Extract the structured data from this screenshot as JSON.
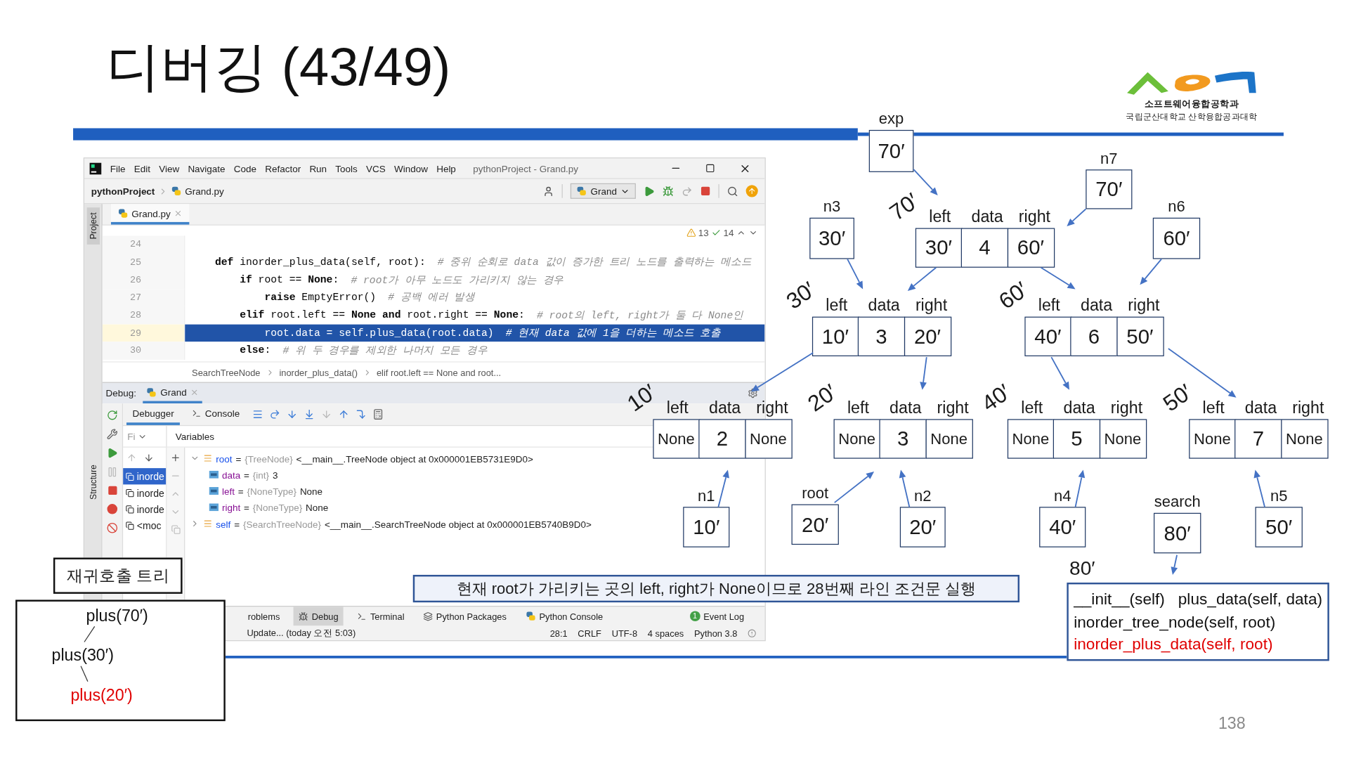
{
  "slide": {
    "title": "디버깅 (43/49)",
    "page_number": "138",
    "logo": {
      "name": "소프트웨어융합공학과",
      "subtitle": "국립군산대학교 산학융합공과대학"
    }
  },
  "ide": {
    "menu": [
      "File",
      "Edit",
      "View",
      "Navigate",
      "Code",
      "Refactor",
      "Run",
      "Tools",
      "VCS",
      "Window",
      "Help"
    ],
    "window_title": "pythonProject - Grand.py",
    "breadcrumb": [
      "pythonProject",
      "Grand.py"
    ],
    "run_config": "Grand",
    "side_tabs": [
      {
        "label": "Project",
        "selected": true
      },
      {
        "label": "Structure",
        "selected": false
      }
    ],
    "editor_tab": {
      "label": "Grand.py",
      "selected": true
    },
    "inspections": {
      "warnings": "13",
      "passed": "14"
    },
    "lines": [
      {
        "number": "24",
        "selected": false
      },
      {
        "number": "25",
        "code": "    **def** inorder_plus_data(self, root):",
        "comment": "# 중위 순회로 data 값이 증가한 트리 노드를 출력하는 메소드",
        "selected": false
      },
      {
        "number": "26",
        "code": "        **if** root == **None**:",
        "comment": "# root가 아무 노드도 가리키지 않는 경우",
        "selected": false
      },
      {
        "number": "27",
        "code": "            **raise** EmptyError()",
        "comment": "# 공백 에러 발생",
        "selected": false
      },
      {
        "number": "28",
        "code": "        **elif** root.left == **None** **and** root.right == **None**:",
        "comment": "# root의 left, right가 둘 다 None인",
        "selected": false
      },
      {
        "number": "29",
        "code": "            root.data = self.plus_data(root.data)",
        "comment": "# 현재 data 값에 1을 더하는 메소드 호출",
        "selected": true
      },
      {
        "number": "30",
        "code": "        **else**:",
        "comment": "# 위 두 경우를 제외한 나머지 모든 경우",
        "selected": false
      }
    ],
    "code_path": [
      "SearchTreeNode",
      "inorder_plus_data()",
      "elif root.left == None and root..."
    ],
    "debug": {
      "label": "Debug:",
      "session": {
        "label": "Grand",
        "selected": true
      },
      "tabs": [
        {
          "label": "Debugger",
          "selected": true
        },
        {
          "label": "Console",
          "selected": false
        }
      ],
      "frames_header": "Fi",
      "frames": [
        {
          "label": "inorde",
          "selected": true
        },
        {
          "label": "inorde",
          "selected": false
        },
        {
          "label": "inorde",
          "selected": false
        },
        {
          "label": "<moc",
          "selected": false
        }
      ],
      "variables_header": "Variables",
      "variables": [
        {
          "kind": "object",
          "name": "root",
          "sep": "=",
          "type": "{TreeNode}",
          "value": "<__main__.TreeNode object at 0x000001EB5731E9D0>",
          "expanded": true,
          "children": [
            {
              "kind": "primitive",
              "name": "data",
              "sep": "=",
              "type": "{int}",
              "value": "3"
            },
            {
              "kind": "primitive",
              "name": "left",
              "sep": "=",
              "type": "{NoneType}",
              "value": "None"
            },
            {
              "kind": "primitive",
              "name": "right",
              "sep": "=",
              "type": "{NoneType}",
              "value": "None"
            }
          ]
        },
        {
          "kind": "object",
          "name": "self",
          "sep": "=",
          "type": "{SearchTreeNode}",
          "value": "<__main__.SearchTreeNode object at 0x000001EB5740B9D0>",
          "expanded": false
        }
      ]
    },
    "tool_tabs": [
      {
        "kind": "problems",
        "label": "roblems",
        "selected": false
      },
      {
        "kind": "debug",
        "label": "Debug",
        "selected": true
      },
      {
        "kind": "terminal",
        "label": "Terminal",
        "selected": false
      },
      {
        "kind": "packages",
        "label": "Python Packages",
        "selected": false
      },
      {
        "kind": "console",
        "label": "Python Console",
        "selected": false
      }
    ],
    "event_log": {
      "label": "Event Log",
      "count": "1"
    },
    "status": {
      "message": "Update... (today 오전 5:03)",
      "position": "28:1",
      "line_separator": "CRLF",
      "encoding": "UTF-8",
      "indent": "4 spaces",
      "interpreter": "Python 3.8"
    }
  },
  "diagram": {
    "triples": [
      {
        "name": "70′",
        "labels": [
          "left",
          "data",
          "right"
        ],
        "cells": [
          "30′",
          "4",
          "60′"
        ]
      },
      {
        "name": "30′",
        "labels": [
          "left",
          "data",
          "right"
        ],
        "cells": [
          "10′",
          "3",
          "20′"
        ]
      },
      {
        "name": "60′",
        "labels": [
          "left",
          "data",
          "right"
        ],
        "cells": [
          "40′",
          "6",
          "50′"
        ]
      },
      {
        "name": "10′",
        "labels": [
          "left",
          "data",
          "right"
        ],
        "cells": [
          "None",
          "2",
          "None"
        ]
      },
      {
        "name": "20′",
        "labels": [
          "left",
          "data",
          "right"
        ],
        "cells": [
          "None",
          "3",
          "None"
        ]
      },
      {
        "name": "40′",
        "labels": [
          "left",
          "data",
          "right"
        ],
        "cells": [
          "None",
          "5",
          "None"
        ]
      },
      {
        "name": "50′",
        "labels": [
          "left",
          "data",
          "right"
        ],
        "cells": [
          "None",
          "7",
          "None"
        ]
      }
    ],
    "singles": [
      {
        "label": "exp",
        "value": "70′"
      },
      {
        "label": "n7",
        "value": "70′"
      },
      {
        "label": "n3",
        "value": "30′"
      },
      {
        "label": "n6",
        "value": "60′"
      },
      {
        "label": "n1",
        "value": "10′"
      },
      {
        "label": "root",
        "value": "20′"
      },
      {
        "label": "n2",
        "value": "20′"
      },
      {
        "label": "n4",
        "value": "40′"
      },
      {
        "label": "search",
        "value": "80′"
      },
      {
        "label": "n5",
        "value": "50′"
      }
    ],
    "new_value": "80′"
  },
  "caption": "현재 root가 가리키는 곳의 left, right가 None이므로 28번째 라인 조건문 실행",
  "recursion_tree": {
    "title": "재귀호출 트리",
    "calls": [
      {
        "text": "plus(70′)",
        "current": false,
        "children": [
          {
            "text": "plus(30′)",
            "current": false,
            "children": [
              {
                "text": "plus(20′)",
                "current": true
              }
            ]
          }
        ]
      }
    ]
  },
  "methods_box": {
    "rows": [
      {
        "items": [
          {
            "text": "__init__(self)",
            "current": false
          },
          {
            "text": "plus_data(self, data)",
            "current": false
          }
        ]
      },
      {
        "items": [
          {
            "text": "inorder_tree_node(self, root)",
            "current": false
          }
        ]
      },
      {
        "items": [
          {
            "text": "inorder_plus_data(self, root)",
            "current": true
          }
        ]
      }
    ]
  }
}
